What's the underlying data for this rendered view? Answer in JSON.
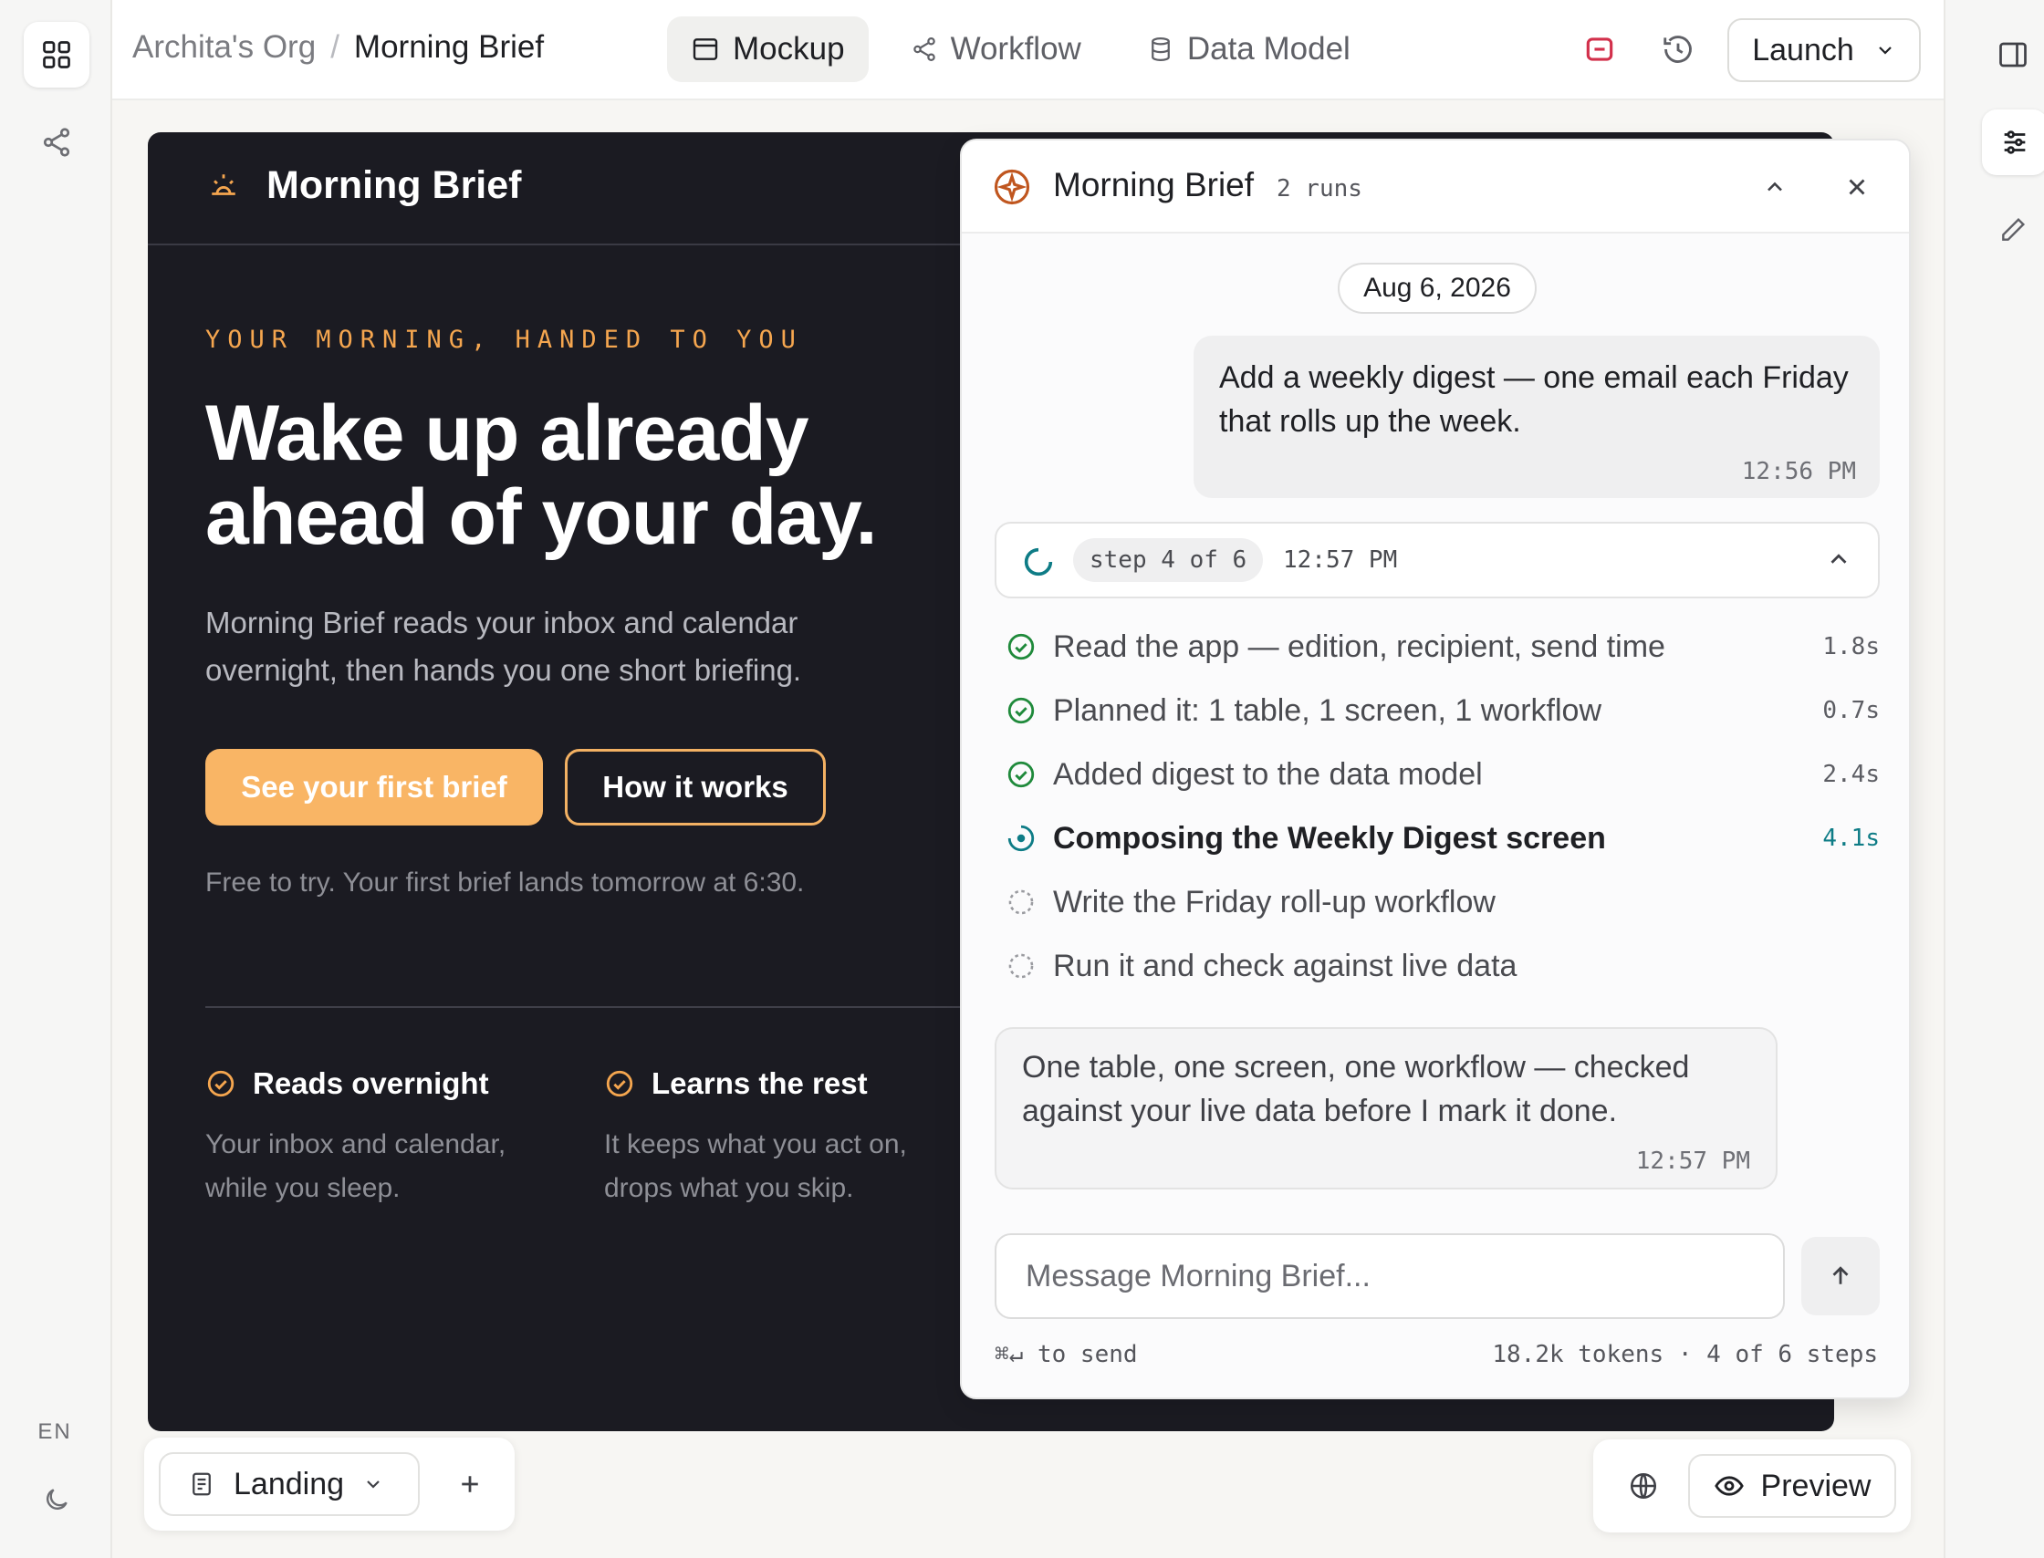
{
  "breadcrumb": {
    "org": "Archita's Org",
    "separator": "/",
    "page": "Morning Brief"
  },
  "top_tabs": [
    {
      "label": "Mockup",
      "icon": "window-icon",
      "active": true
    },
    {
      "label": "Workflow",
      "icon": "share-nodes-icon",
      "active": false
    },
    {
      "label": "Data Model",
      "icon": "database-icon",
      "active": false
    }
  ],
  "toolbar": {
    "launch_label": "Launch"
  },
  "left_rail": {
    "lang": "EN"
  },
  "mockup": {
    "brand": "Morning Brief",
    "eyebrow": "YOUR MORNING, HANDED TO YOU",
    "hero_line1": "Wake up already",
    "hero_line2": "ahead of your day.",
    "subtitle": "Morning Brief reads your inbox and calendar overnight, then hands you one short briefing.",
    "cta_primary": "See your first brief",
    "cta_secondary": "How it works",
    "note": "Free to try. Your first brief lands tomorrow at 6:30.",
    "features": [
      {
        "title": "Reads overnight",
        "body": "Your inbox and calendar, while you sleep."
      },
      {
        "title": "Learns the rest",
        "body": "It keeps what you act on, drops what you skip."
      }
    ]
  },
  "chat": {
    "title": "Morning Brief",
    "runs": "2 runs",
    "date": "Aug 6, 2026",
    "user_message": "Add a weekly digest — one email each Friday that rolls up the week.",
    "user_time": "12:56 PM",
    "step_pill": "step 4 of 6",
    "step_time": "12:57 PM",
    "steps": [
      {
        "label": "Read the app — edition, recipient, send time",
        "duration": "1.8s",
        "status": "done"
      },
      {
        "label": "Planned it: 1 table, 1 screen, 1 workflow",
        "duration": "0.7s",
        "status": "done"
      },
      {
        "label": "Added digest to the data model",
        "duration": "2.4s",
        "status": "done"
      },
      {
        "label": "Composing the Weekly Digest screen",
        "duration": "4.1s",
        "status": "running"
      },
      {
        "label": "Write the Friday roll-up workflow",
        "duration": "",
        "status": "pending"
      },
      {
        "label": "Run it and check against live data",
        "duration": "",
        "status": "pending"
      }
    ],
    "ai_message": "One table, one screen, one workflow — checked against your live data before I mark it done.",
    "ai_time": "12:57 PM",
    "input_placeholder": "Message Morning Brief...",
    "send_hint": "⌘↵ to send",
    "stats": "18.2k tokens · 4 of 6 steps"
  },
  "bottom": {
    "page_label": "Landing",
    "preview_label": "Preview"
  },
  "colors": {
    "accent": "#f9b565",
    "mockup_bg": "#1b1b22",
    "done": "#1f8a3b",
    "running": "#0e7c86",
    "stop": "#d2304b"
  }
}
